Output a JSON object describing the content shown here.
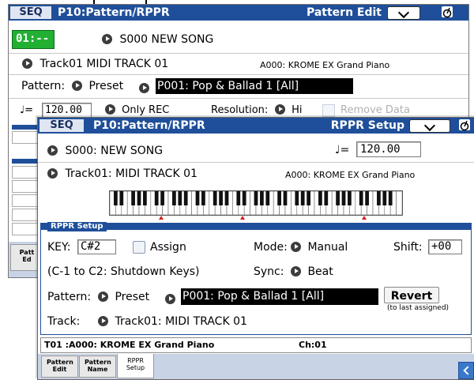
{
  "back": {
    "seq_label": "SEQ",
    "page_title": "P10:Pattern/RPPR",
    "tab_title": "Pattern Edit",
    "measure": "01:---",
    "song": "S000 NEW SONG",
    "track": "Track01 MIDI TRACK 01",
    "program": "A000: KROME EX Grand Piano",
    "pattern_label": "Pattern:",
    "pattern_bank": "Preset",
    "pattern_value": "P001: Pop & Ballad 1 [All]",
    "tempo_symbol": "♩=",
    "tempo": "120.00",
    "only_rec": "Only REC",
    "resolution_label": "Resolution:",
    "resolution_value": "Hi",
    "remove_data": "Remove Data",
    "side_tab_line1": "Patt",
    "side_tab_line2": "Ed"
  },
  "front": {
    "seq_label": "SEQ",
    "page_title": "P10:Pattern/RPPR",
    "tab_title": "RPPR Setup",
    "song": "S000: NEW SONG",
    "tempo_symbol": "♩=",
    "tempo": "120.00",
    "track": "Track01: MIDI TRACK 01",
    "program": "A000: KROME EX Grand Piano",
    "section_title": "RPPR Setup",
    "key_label": "KEY:",
    "key_value": "C#2",
    "assign_label": "Assign",
    "mode_label": "Mode:",
    "mode_value": "Manual",
    "shift_label": "Shift:",
    "shift_value": "+00",
    "shutdown_keys": "(C-1 to C2: Shutdown Keys)",
    "sync_label": "Sync:",
    "sync_value": "Beat",
    "pattern_label": "Pattern:",
    "pattern_bank": "Preset",
    "pattern_value": "P001: Pop & Ballad 1 [All]",
    "revert_label": "Revert",
    "revert_note": "(to last assigned)",
    "track_label": "Track:",
    "track_value": "Track01: MIDI TRACK 01",
    "status_track": "T01 :A000: KROME EX Grand Piano",
    "status_channel": "Ch:01",
    "tabs": [
      "Pattern Edit",
      "Pattern Name",
      "RPPR Setup"
    ]
  },
  "colors": {
    "title_blue": "#1f4f9a",
    "measure_green": "#22b032",
    "key_marker_red": "#d21f1f"
  }
}
